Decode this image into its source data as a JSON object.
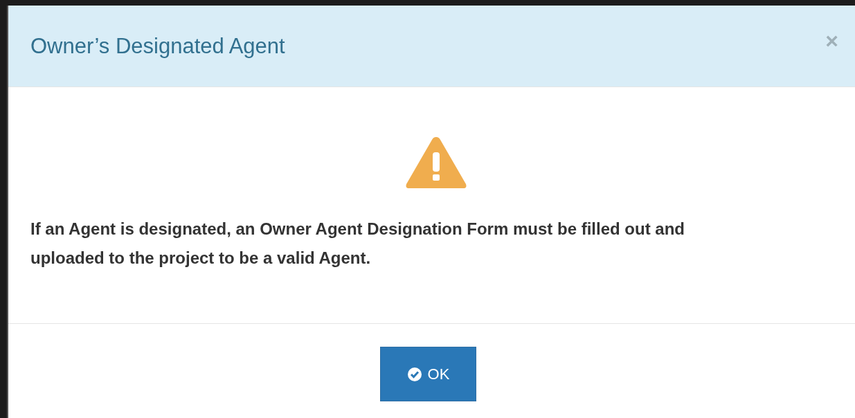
{
  "dialog": {
    "title": "Owner’s Designated Agent",
    "close_label": "×",
    "message": "If an Agent is designated, an Owner Agent Designation Form must be filled out and uploaded to the project to be a valid Agent.",
    "buttons": [
      {
        "label": "OK"
      }
    ]
  }
}
